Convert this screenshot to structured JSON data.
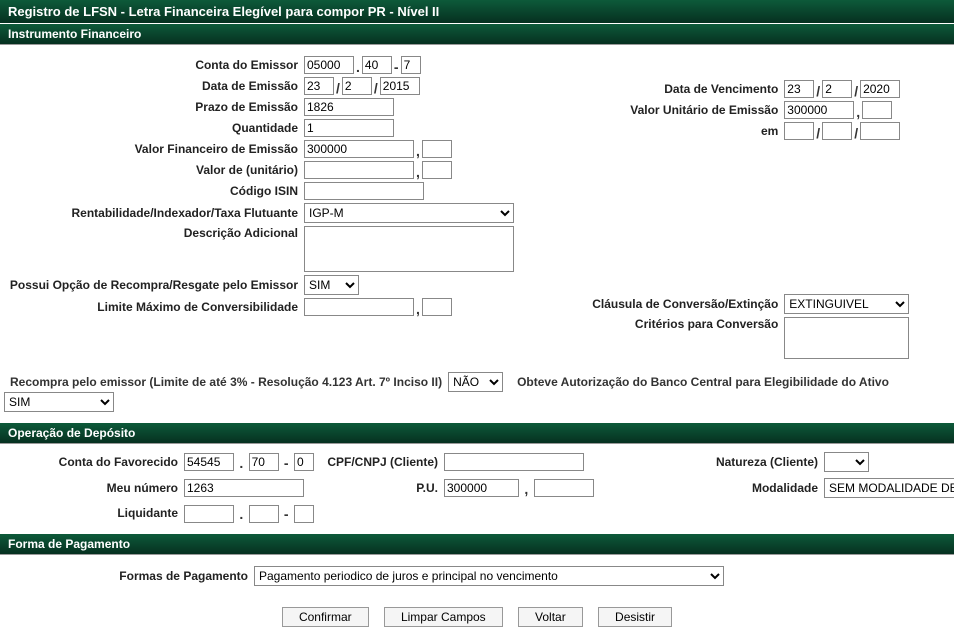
{
  "page_title": "Registro de LFSN - Letra Financeira Elegível para compor PR - Nível II",
  "sections": {
    "instrumento": "Instrumento Financeiro",
    "operacao": "Operação de Depósito",
    "forma": "Forma de Pagamento"
  },
  "labels": {
    "conta_emissor": "Conta do Emissor",
    "data_emissao": "Data de Emissão",
    "prazo_emissao": "Prazo de Emissão",
    "quantidade": "Quantidade",
    "valor_fin_emissao": "Valor Financeiro de Emissão",
    "valor_unitario_label": "Valor de (unitário)",
    "codigo_isin": "Código ISIN",
    "rentab": "Rentabilidade/Indexador/Taxa Flutuante",
    "descricao": "Descrição Adicional",
    "opcao_recompra": "Possui Opção de Recompra/Resgate pelo Emissor",
    "limite_conv": "Limite Máximo de Conversibilidade",
    "data_venc": "Data de Vencimento",
    "valor_unit_emissao": "Valor Unitário de Emissão",
    "em": "em",
    "clausula": "Cláusula de Conversão/Extinção",
    "criterios": "Critérios para Conversão",
    "recompra_limite": "Recompra pelo emissor (Limite de até 3% - Resolução 4.123 Art. 7º Inciso II)",
    "obteve_aut": "Obteve Autorização do Banco Central para Elegibilidade do Ativo",
    "conta_favorecido": "Conta do Favorecido",
    "cpf_cnpj": "CPF/CNPJ (Cliente)",
    "natureza": "Natureza (Cliente)",
    "meu_numero": "Meu número",
    "pu": "P.U.",
    "modalidade": "Modalidade",
    "liquidante": "Liquidante",
    "formas_pag": "Formas de Pagamento"
  },
  "values": {
    "conta_emissor_1": "05000",
    "conta_emissor_2": "40",
    "conta_emissor_3": "7",
    "data_emissao_d": "23",
    "data_emissao_m": "2",
    "data_emissao_y": "2015",
    "prazo_emissao": "1826",
    "quantidade": "1",
    "valor_fin_emissao_int": "300000",
    "valor_fin_emissao_dec": "",
    "valor_unit_int": "",
    "valor_unit_dec": "",
    "codigo_isin": "",
    "rentab": "IGP-M",
    "descricao": "",
    "opcao_recompra": "SIM",
    "limite_conv_int": "",
    "limite_conv_dec": "",
    "data_venc_d": "23",
    "data_venc_m": "2",
    "data_venc_y": "2020",
    "valor_unit_emissao_int": "300000",
    "valor_unit_emissao_dec": "",
    "em_d": "",
    "em_m": "",
    "em_y": "",
    "clausula": "EXTINGUIVEL",
    "criterios": "",
    "recompra_sel": "NÃO",
    "obteve_sel": "SIM",
    "conta_fav_1": "54545",
    "conta_fav_2": "70",
    "conta_fav_3": "0",
    "cpf_cnpj": "",
    "natureza": "",
    "meu_numero": "1263",
    "pu_int": "300000",
    "pu_dec": "",
    "modalidade": "SEM MODALIDADE DE LIQUIDACAO",
    "liquidante_1": "",
    "liquidante_2": "",
    "liquidante_3": "",
    "formas_pag": "Pagamento periodico de juros e principal no vencimento"
  },
  "buttons": {
    "confirmar": "Confirmar",
    "limpar": "Limpar Campos",
    "voltar": "Voltar",
    "desistir": "Desistir"
  },
  "sep_dot": ".",
  "sep_dash": "-",
  "sep_slash": "/",
  "sep_comma": ","
}
